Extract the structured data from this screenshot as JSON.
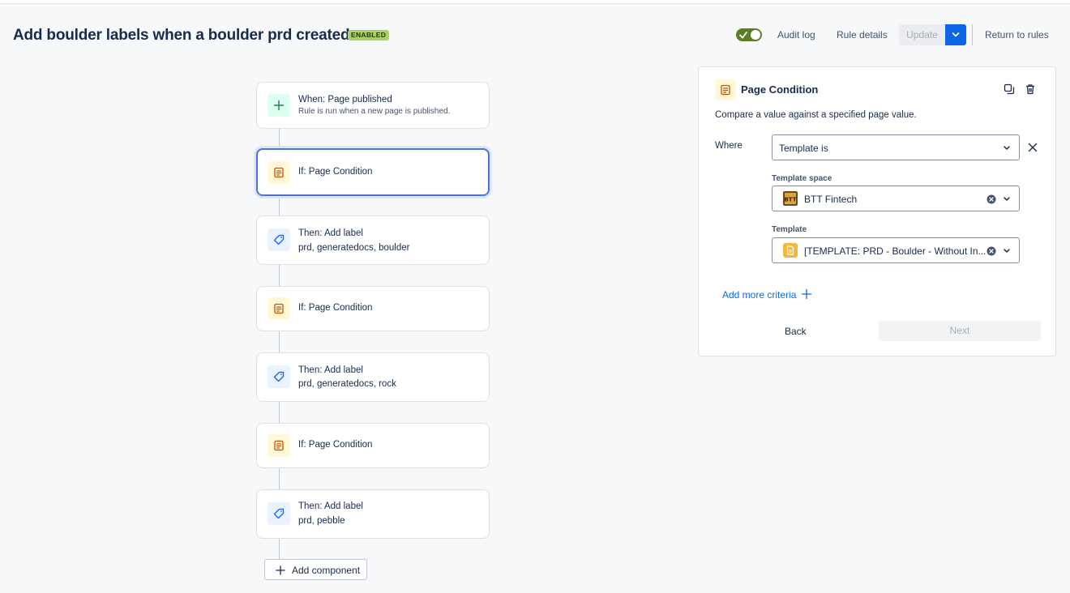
{
  "header": {
    "title": "Add boulder labels when a boulder prd created",
    "status": "ENABLED",
    "toggle_on": true,
    "audit_log": "Audit log",
    "rule_details": "Rule details",
    "update": "Update",
    "return_to_rules": "Return to rules",
    "accent_color": "#0c66e4"
  },
  "flow": {
    "steps": [
      {
        "title": "When: Page published",
        "subtitle": "Rule is run when a new page is published.",
        "icon": "plus-icon",
        "selected": false
      },
      {
        "title": "If: Page Condition",
        "subtitle": "",
        "icon": "page-condition-icon",
        "selected": true
      },
      {
        "title": "Then: Add label",
        "subtitle": "prd, generatedocs, boulder",
        "icon": "label-icon",
        "selected": false
      },
      {
        "title": "If: Page Condition",
        "subtitle": "",
        "icon": "page-condition-icon",
        "selected": false
      },
      {
        "title": "Then: Add label",
        "subtitle": "prd, generatedocs, rock",
        "icon": "label-icon",
        "selected": false
      },
      {
        "title": "If: Page Condition",
        "subtitle": "",
        "icon": "page-condition-icon",
        "selected": false
      },
      {
        "title": "Then: Add label",
        "subtitle": "prd, pebble",
        "icon": "label-icon",
        "selected": false
      }
    ],
    "add_component": "Add component"
  },
  "panel": {
    "title": "Page Condition",
    "description": "Compare a value against a specified page value.",
    "where_label": "Where",
    "where_value": "Template is",
    "template_space_label": "Template space",
    "template_space_value": "BTT Fintech",
    "template_label": "Template",
    "template_value": "[TEMPLATE: PRD - Boulder - Without In...",
    "add_more_criteria": "Add more criteria",
    "back": "Back",
    "next": "Next"
  }
}
